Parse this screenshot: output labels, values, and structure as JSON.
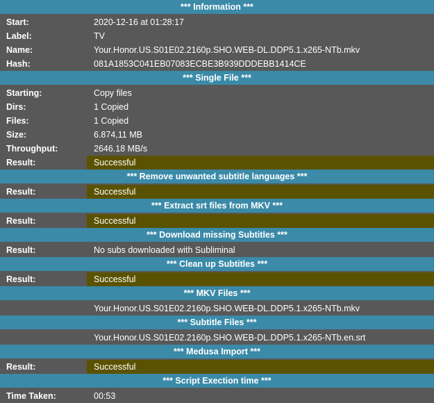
{
  "sections": [
    {
      "title": "*** Information ***",
      "rows": [
        {
          "key": "Start:",
          "value": "2020-12-16 at 01:28:17",
          "ok": false
        },
        {
          "key": "Label:",
          "value": "TV",
          "ok": false
        },
        {
          "key": "Name:",
          "value": "Your.Honor.US.S01E02.2160p.SHO.WEB-DL.DDP5.1.x265-NTb.mkv",
          "ok": false
        },
        {
          "key": "Hash:",
          "value": "081A1853C041EB07083ECBE3B939DDDEBB1414CE",
          "ok": false
        }
      ]
    },
    {
      "title": "*** Single File ***",
      "rows": [
        {
          "key": "Starting:",
          "value": "Copy files",
          "ok": false
        },
        {
          "key": "Dirs:",
          "value": "1 Copied",
          "ok": false
        },
        {
          "key": "Files:",
          "value": "1 Copied",
          "ok": false
        },
        {
          "key": "Size:",
          "value": "6.874,11 MB",
          "ok": false
        },
        {
          "key": "Throughput:",
          "value": "2646.18 MB/s",
          "ok": false
        },
        {
          "key": "Result:",
          "value": "Successful",
          "ok": true
        }
      ]
    },
    {
      "title": "*** Remove unwanted subtitle languages ***",
      "rows": [
        {
          "key": "Result:",
          "value": "Successful",
          "ok": true
        }
      ]
    },
    {
      "title": "*** Extract srt files from MKV ***",
      "rows": [
        {
          "key": "Result:",
          "value": "Successful",
          "ok": true
        }
      ]
    },
    {
      "title": "*** Download missing Subtitles ***",
      "rows": [
        {
          "key": "Result:",
          "value": "No subs downloaded with Subliminal",
          "ok": false
        }
      ]
    },
    {
      "title": "*** Clean up Subtitles ***",
      "rows": [
        {
          "key": "Result:",
          "value": "Successful",
          "ok": true
        }
      ]
    },
    {
      "title": "*** MKV Files ***",
      "rows": [
        {
          "key": "",
          "value": "Your.Honor.US.S01E02.2160p.SHO.WEB-DL.DDP5.1.x265-NTb.mkv",
          "ok": false
        }
      ]
    },
    {
      "title": "*** Subtitle Files ***",
      "rows": [
        {
          "key": "",
          "value": "Your.Honor.US.S01E02.2160p.SHO.WEB-DL.DDP5.1.x265-NTb.en.srt",
          "ok": false
        }
      ]
    },
    {
      "title": "*** Medusa Import ***",
      "rows": [
        {
          "key": "Result:",
          "value": "Successful",
          "ok": true
        }
      ]
    },
    {
      "title": "*** Script Exection time ***",
      "rows": [
        {
          "key": "Time Taken:",
          "value": "00:53",
          "ok": false
        }
      ]
    }
  ]
}
